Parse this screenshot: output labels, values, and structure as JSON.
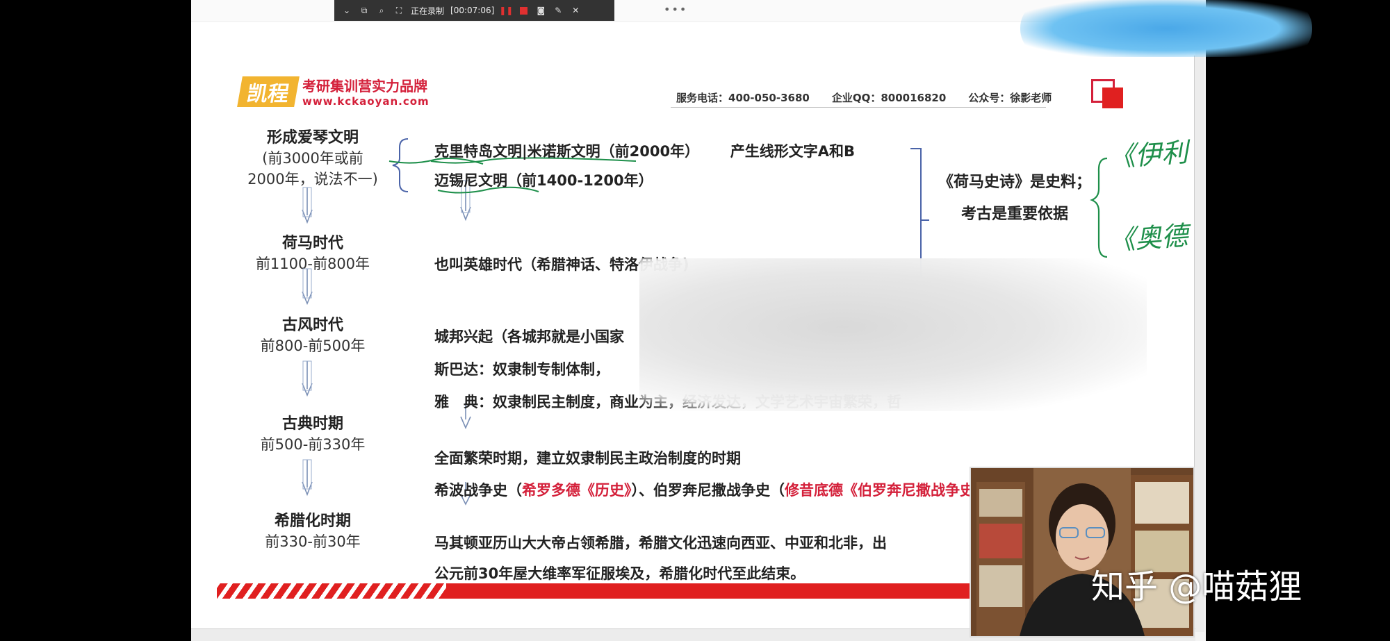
{
  "recorder": {
    "status_label": "正在录制",
    "elapsed": "[00:07:06]"
  },
  "brand": {
    "logo_text": "凯程",
    "slogan": "考研集训营实力品牌",
    "url": "www.kckaoyan.com"
  },
  "header": {
    "phone": "服务电话：400-050-3680",
    "qq": "企业QQ：800016820",
    "wechat": "公众号：徐影老师"
  },
  "eras": [
    {
      "name": "形成爱琴文明",
      "date_line1": "(前3000年或前",
      "date_line2": "2000年，说法不一)"
    },
    {
      "name": "荷马时代",
      "date_line1": "前1100-前800年"
    },
    {
      "name": "古风时代",
      "date_line1": "前800-前500年"
    },
    {
      "name": "古典时期",
      "date_line1": "前500-前330年"
    },
    {
      "name": "希腊化时期",
      "date_line1": "前330-前30年"
    }
  ],
  "aegean": {
    "line1_a": "克里特岛文明|米诺斯文明（前2000年）",
    "line1_b": "产生线形文字A和B",
    "line2": "迈锡尼文明（前1400-1200年）"
  },
  "homer_desc": "也叫英雄时代（希腊神话、特洛伊战争)",
  "archaic": {
    "line1": "城邦兴起（各城邦就是小国家",
    "line2": "斯巴达：奴隶制专制体制，",
    "line3": "雅　典：奴隶制民主制度，商业为主，经济发达，文学艺术宇宙繁荣，哲"
  },
  "classical": {
    "line1": "全面繁荣时期，建立奴隶制民主政治制度的时期",
    "line2_a": "希波战争史（",
    "line2_red1": "希罗多德《历史》",
    "line2_b": "）、伯罗奔尼撒战争史（",
    "line2_red2": "修昔底德《伯罗奔尼撒战争史》",
    "line2_c": "）"
  },
  "hellenistic": {
    "line1": "马其顿亚历山大大帝占领希腊，希腊文化迅速向西亚、中亚和北非，出",
    "line2": "公元前30年屋大维率军征服埃及，希腊化时代至此结束。"
  },
  "side_note": {
    "line1": "《荷马史诗》是史料；",
    "line2": "考古是重要依据",
    "hand1": "《伊利",
    "hand2": "《奥德"
  },
  "watermark": "知乎 @喵菇狸",
  "colors": {
    "brand_red": "#d4203a",
    "arrow_blue": "#7a8fb5",
    "brace_blue": "#4a63a8",
    "underline_green": "#1e8f4a"
  }
}
